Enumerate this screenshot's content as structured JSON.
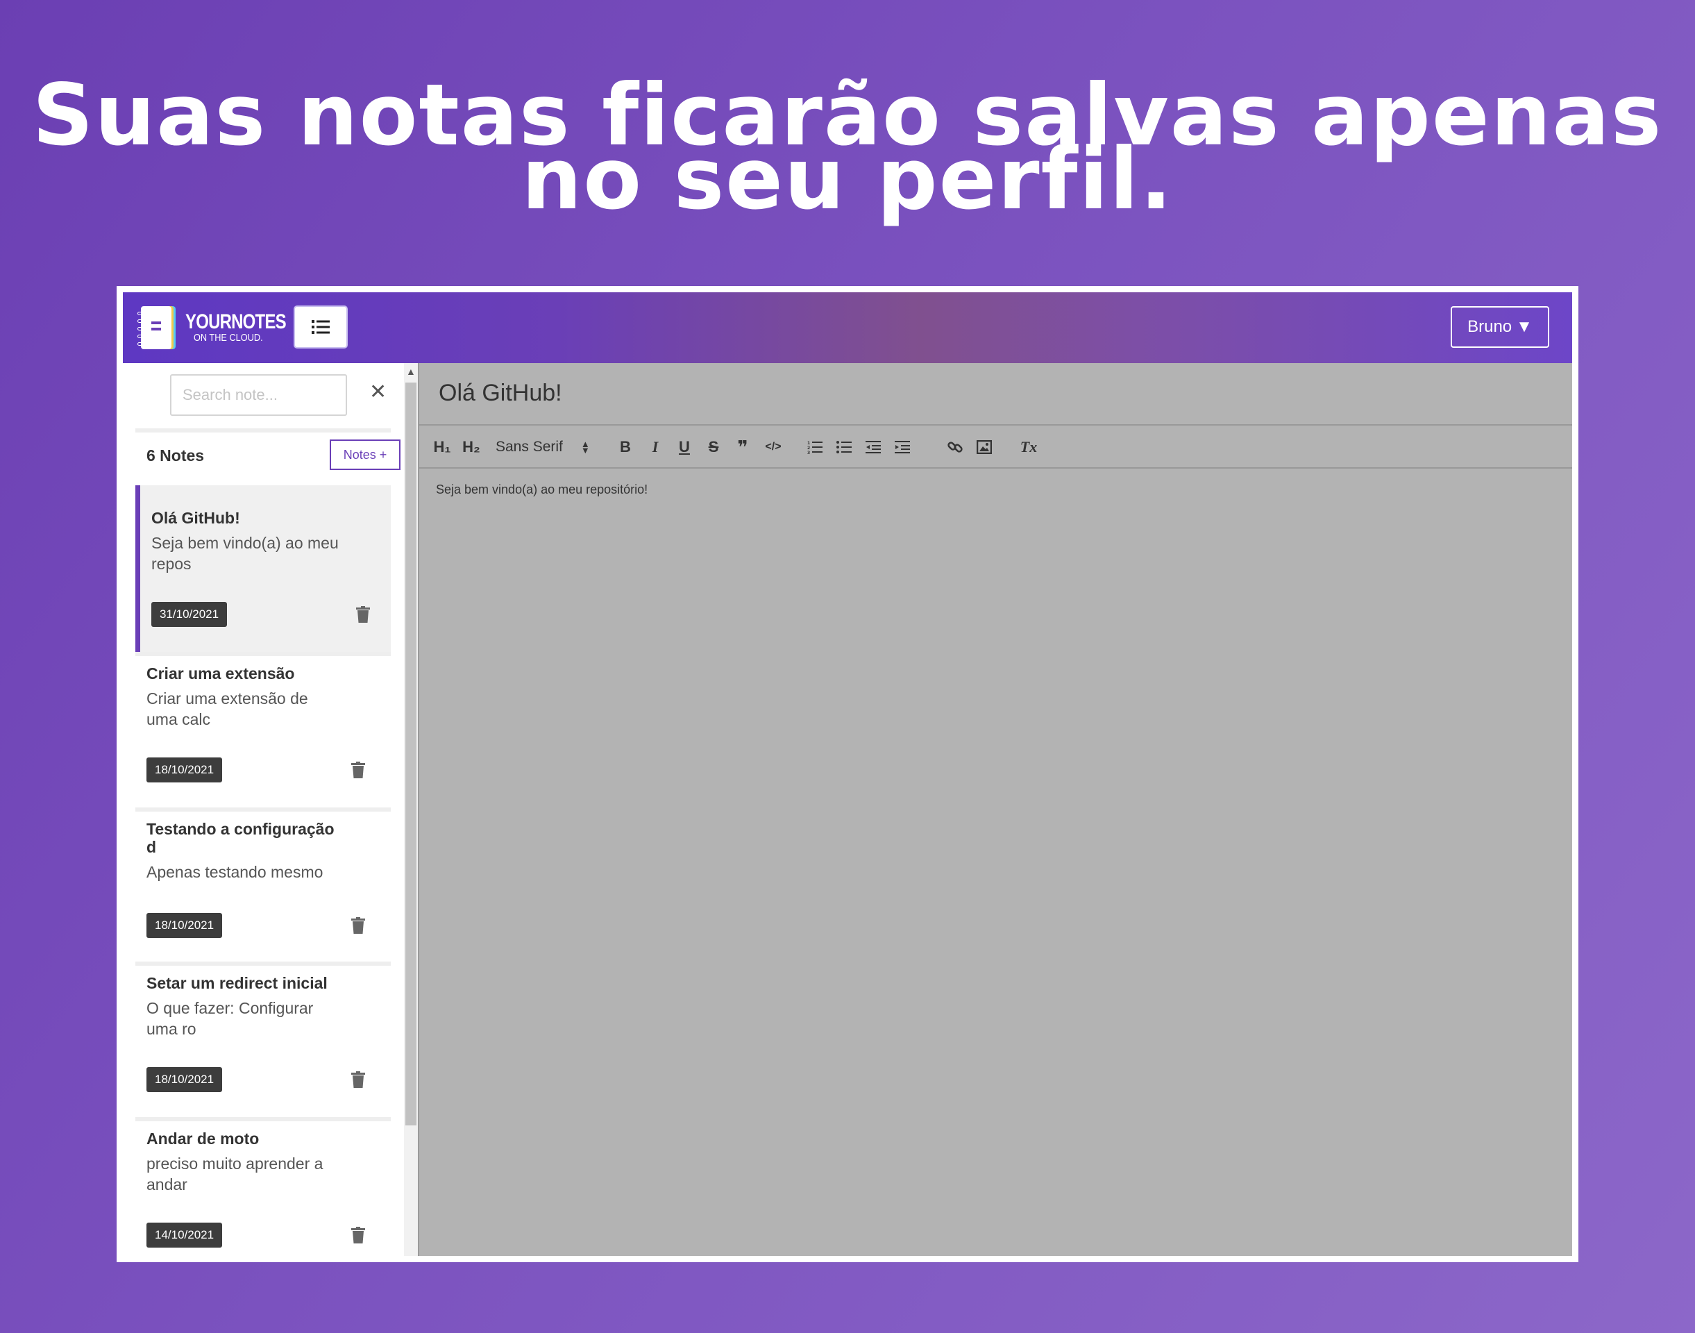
{
  "headline": {
    "line1": "Suas notas ficarão salvas apenas",
    "line2": "no seu perfil."
  },
  "header": {
    "logo_line1": "YOURNOTES",
    "logo_line2": "ON THE CLOUD.",
    "user_label": "Bruno"
  },
  "sidebar": {
    "search_placeholder": "Search note...",
    "count_label": "6 Notes",
    "add_button": "Notes +",
    "notes": [
      {
        "title": "Olá GitHub!",
        "preview": "Seja bem vindo(a) ao meu repos",
        "date": "31/10/2021",
        "active": true
      },
      {
        "title": "Criar uma extensão",
        "preview": "Criar uma extensão de uma calc",
        "date": "18/10/2021"
      },
      {
        "title": "Testando a configuração d",
        "preview": "Apenas testando mesmo",
        "date": "18/10/2021"
      },
      {
        "title": "Setar um redirect inicial",
        "preview": "O que fazer: Configurar uma ro",
        "date": "18/10/2021"
      },
      {
        "title": "Andar de moto",
        "preview": "preciso muito aprender a andar",
        "date": "14/10/2021"
      }
    ]
  },
  "editor": {
    "title": "Olá GitHub!",
    "toolbar": {
      "h1": "H₁",
      "h2": "H₂",
      "font": "Sans Serif",
      "bold": "B",
      "italic": "I",
      "underline": "U",
      "strike": "S",
      "blockquote": "❞",
      "code": "</>",
      "clean": "Tx"
    },
    "body": "Seja bem vindo(a) ao meu repositório!"
  },
  "colors": {
    "brand": "#6a3fb7",
    "editor_bg": "#b3b3b3",
    "date_badge": "#3d3d3d"
  }
}
